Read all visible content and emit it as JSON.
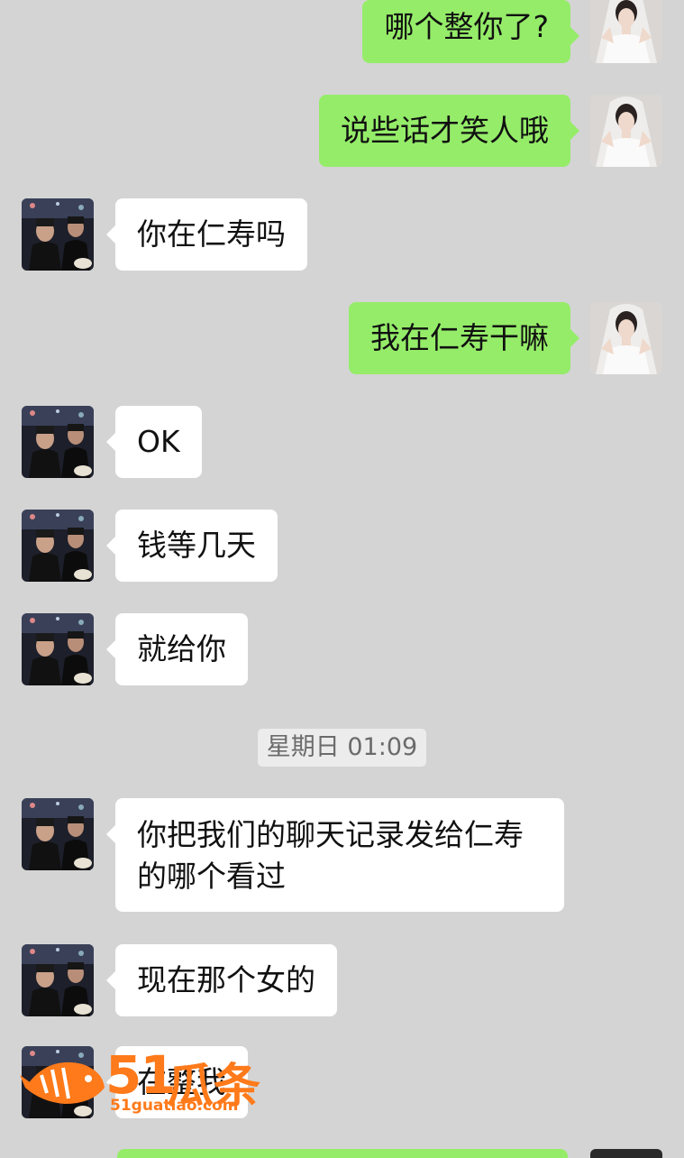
{
  "messages": [
    {
      "side": "out",
      "text": "哪个整你了?"
    },
    {
      "side": "out",
      "text": "说些话才笑人哦"
    },
    {
      "side": "in",
      "text": "你在仁寿吗"
    },
    {
      "side": "out",
      "text": "我在仁寿干嘛"
    },
    {
      "side": "in",
      "text": "OK"
    },
    {
      "side": "in",
      "text": "钱等几天"
    },
    {
      "side": "in",
      "text": "就给你"
    },
    {
      "side": "in",
      "text": "你把我们的聊天记录发给仁寿\n的哪个看过"
    },
    {
      "side": "in",
      "text": "现在那个女的"
    },
    {
      "side": "in",
      "text": "在整我"
    }
  ],
  "timestamp": "星期日 01:09",
  "watermark": {
    "brand_number": "51",
    "brand_text": "瓜条",
    "url": "51guatiao.com"
  },
  "colors": {
    "background": "#d4d4d4",
    "outgoing_bubble": "#95ec69",
    "incoming_bubble": "#ffffff",
    "watermark": "#ff7a1a"
  }
}
